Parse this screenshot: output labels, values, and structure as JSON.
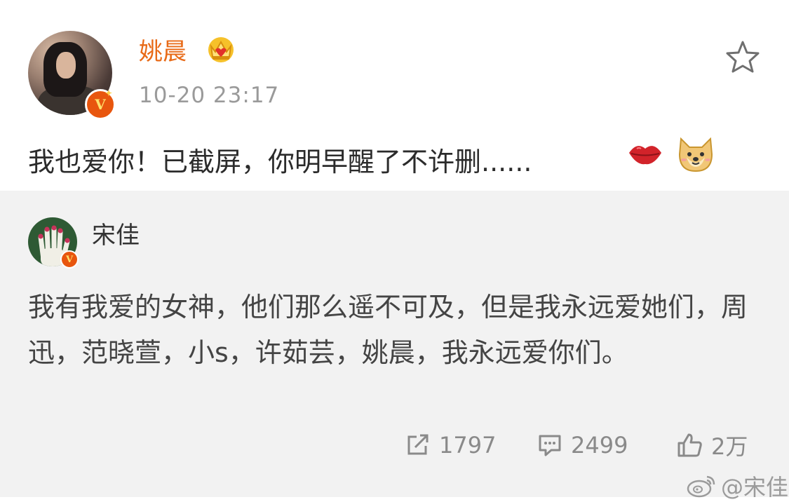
{
  "post": {
    "author": "姚晨",
    "timestamp": "10-20 23:17",
    "text": "我也爱你！已截屏，你明早醒了不许删......",
    "icons": [
      "crown-icon",
      "verified-badge-icon",
      "star-icon",
      "lips-emoji-icon",
      "doge-emoji-icon"
    ]
  },
  "repost": {
    "author": "宋佳",
    "text": "我有我爱的女神，他们那么遥不可及，但是我永远爱她们，周迅，范晓萱，小s，许茹芸，姚晨，我永远爱你们。",
    "stats": {
      "reposts": "1797",
      "comments": "2499",
      "likes": "2万"
    }
  },
  "watermark": "@宋佳",
  "colors": {
    "username": "#e86a17",
    "verified": "#e8560e",
    "repost_background": "#f2f2f2",
    "muted": "#9a9a9a"
  }
}
